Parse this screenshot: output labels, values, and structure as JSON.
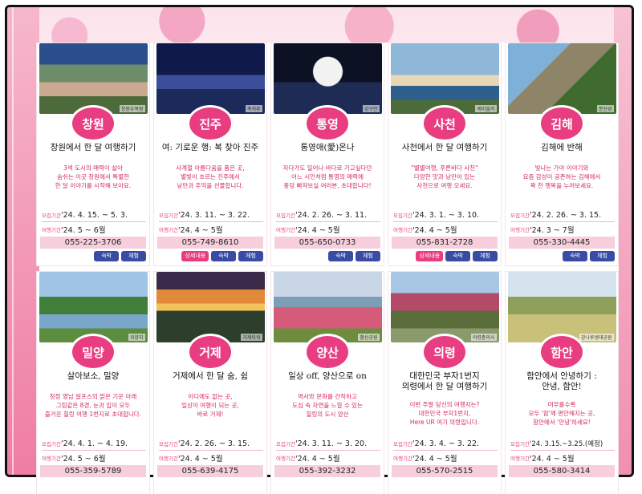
{
  "labels": {
    "period": "모집기간",
    "travel": "여행기간",
    "stay": "숙박",
    "exp": "체험",
    "detail": "상세내용"
  },
  "cards": [
    {
      "city": "창원",
      "photo_caption": "창원수목원",
      "title": "창원에서 한 달 여행하기",
      "desc": "3색 도시의 매력이 살아\n숨쉬는 이곳 창원에서 특별한\n한 달 이야기를 시작해 보아요.",
      "period": "'24. 4. 15. ~ 5. 3.",
      "travel": "'24. 5 ~ 6월",
      "phone": "055-225-3706"
    },
    {
      "city": "진주",
      "photo_caption": "촉석루",
      "title": "여: 기로운  행: 복 찾아 진주",
      "desc": "사계절 아름다움을 품은 곳,\n별빛이 흐르는 진주에서\n낭만과 추억을 선물합니다.",
      "period": "'24. 3. 11. ~ 3. 22.",
      "travel": "'24. 4 ~ 5월",
      "phone": "055-749-8610"
    },
    {
      "city": "통영",
      "photo_caption": "강구안",
      "title": "통영애(愛)온나",
      "desc": "자다가도 일어나 바다로 가고싶다던\n어느 시인처럼 통영의 매력에\n풍덩 빠져보실 여러분, 초대합니다!",
      "period": "'24. 2. 26. ~ 3. 11.",
      "travel": "'24. 4 ~ 5월",
      "phone": "055-650-0733"
    },
    {
      "city": "사천",
      "photo_caption": "케이블카",
      "title": "사천에서 한 달 여행하기",
      "desc": "\"별별여행, 푸른바다 사천\"\n다양한 맛과 낭만이 있는\n사천으로 여행 오세요.",
      "period": "'24. 3. 1. ~ 3. 10.",
      "travel": "'24. 4 ~ 5월",
      "phone": "055-831-2728"
    },
    {
      "city": "김해",
      "photo_caption": "분산성",
      "title": "김해에 반해",
      "desc": "빛나는 가야 이야기와\n요즘 감성이 공존하는 김해에서\n꽉 찬 행복을 누려보세요.",
      "period": "'24. 2. 26. ~ 3. 15.",
      "travel": "'24. 3 ~ 7월",
      "phone": "055-330-4445"
    },
    {
      "city": "밀양",
      "photo_caption": "위양지",
      "title": "살아보소, 밀양",
      "desc": "청정 영남 알프스의 맑은 기운 아래\n그림같은 8경, 눈과 입이 모두\n즐거운 힐링 여행 1번지로 초대합니다.",
      "period": "'24. 4. 1. ~ 4. 19.",
      "travel": "'24. 5 ~ 6월",
      "phone": "055-359-5789"
    },
    {
      "city": "거제",
      "photo_caption": "거제타워",
      "title": "거제에서 한 달 숨, 쉼",
      "desc": "어디에도 없는 곳,\n일상이 여행이 되는 곳,\n바로 거제!",
      "period": "'24. 2. 26. ~ 3. 15.",
      "travel": "'24. 4 ~ 5월",
      "phone": "055-639-4175"
    },
    {
      "city": "양산",
      "photo_caption": "황산공원",
      "title": "일상 off, 양산으로 on",
      "desc": "역사와 문화를 간직하고\n도심 속 자연을 느낄 수 있는\n힐링의 도시 양산",
      "period": "'24. 3. 11. ~ 3. 20.",
      "travel": "'24. 4 ~ 5월",
      "phone": "055-392-3232"
    },
    {
      "city": "의령",
      "photo_caption": "의령충의사",
      "title": "대한민국 부자1번지\n의령에서 한 달 여행하기",
      "desc": "이번 주말 당신의 여행지는?\n대한민국 부자1번지,\nHere UR 여기 의령입니다.",
      "period": "'24. 3. 4. ~ 3. 22.",
      "travel": "'24. 4 ~ 5월",
      "phone": "055-570-2515"
    },
    {
      "city": "함안",
      "photo_caption": "강나루생태공원",
      "title": "함안에서 안녕하기 :\n안녕, 함안!",
      "desc": "머무를수록\n모두 '함'께 편안해지는 곳,\n함안에서 '안녕'하세요!",
      "period": "'24. 3.15.~3.25.(예정)",
      "travel": "'24. 4 ~ 5월",
      "phone": "055-580-3414"
    }
  ]
}
